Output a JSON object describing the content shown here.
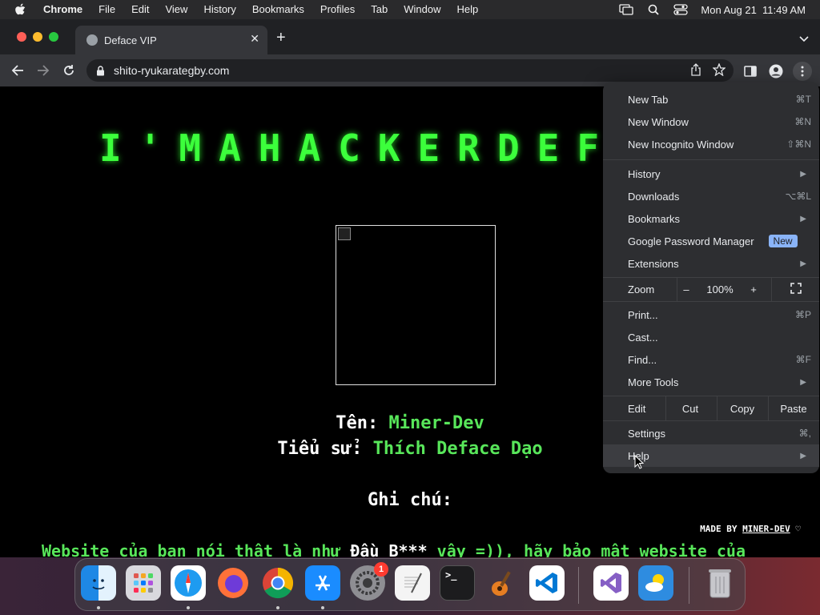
{
  "menubar": {
    "app_name": "Chrome",
    "items": [
      "File",
      "Edit",
      "View",
      "History",
      "Bookmarks",
      "Profiles",
      "Tab",
      "Window",
      "Help"
    ],
    "clock": "Mon Aug 21  11:49 AM"
  },
  "browser": {
    "tab_title": "Deface VIP",
    "url": "shito-ryukarategby.com"
  },
  "page": {
    "title": "I'MAHACKERDEFA",
    "name_label": "Tên: ",
    "name_value": "Miner-Dev",
    "bio_label": "Tiểu sử: ",
    "bio_value": "Thích Deface Dạo",
    "note_label": "Ghi chú:",
    "made_by_prefix": "MADE BY ",
    "made_by_name": "MINER-DEV",
    "made_by_heart": " ♡",
    "message_start": "Website của bạn nói thật là như ",
    "message_white": "Đầu B***",
    "message_end": " vậy =)), hãy bảo mật website của"
  },
  "chrome_menu": {
    "new_tab": {
      "label": "New Tab",
      "shortcut": "⌘T"
    },
    "new_window": {
      "label": "New Window",
      "shortcut": "⌘N"
    },
    "new_incognito": {
      "label": "New Incognito Window",
      "shortcut": "⇧⌘N"
    },
    "history": {
      "label": "History"
    },
    "downloads": {
      "label": "Downloads",
      "shortcut": "⌥⌘L"
    },
    "bookmarks": {
      "label": "Bookmarks"
    },
    "password_manager": {
      "label": "Google Password Manager",
      "badge": "New"
    },
    "extensions": {
      "label": "Extensions"
    },
    "zoom": {
      "label": "Zoom",
      "minus": "–",
      "value": "100%",
      "plus": "+"
    },
    "print": {
      "label": "Print...",
      "shortcut": "⌘P"
    },
    "cast": {
      "label": "Cast..."
    },
    "find": {
      "label": "Find...",
      "shortcut": "⌘F"
    },
    "more_tools": {
      "label": "More Tools"
    },
    "edit": {
      "label": "Edit",
      "cut": "Cut",
      "copy": "Copy",
      "paste": "Paste"
    },
    "settings": {
      "label": "Settings",
      "shortcut": "⌘,"
    },
    "help": {
      "label": "Help"
    }
  },
  "dock": {
    "settings_badge": "1"
  },
  "colors": {
    "hacker_green": "#3cff3c",
    "value_green": "#58e65a",
    "menu_bg": "#2d2e31",
    "new_badge": "#8ab4f8"
  }
}
